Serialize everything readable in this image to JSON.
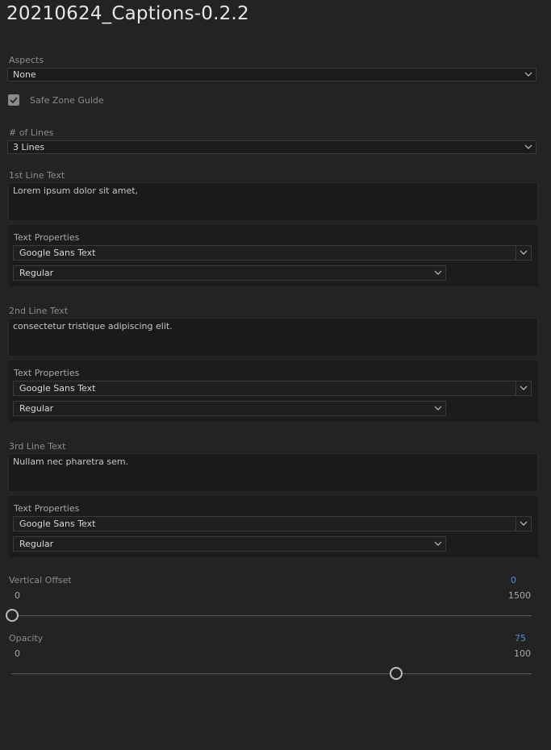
{
  "app": {
    "title": "20210624_Captions-0.2.2"
  },
  "aspects": {
    "label": "Aspects",
    "value": "None"
  },
  "safe_zone": {
    "label": "Safe Zone Guide",
    "checked": true
  },
  "lines": {
    "label": "# of Lines",
    "value": "3 Lines"
  },
  "text_lines": [
    {
      "label": "1st Line Text",
      "value": "Lorem ipsum dolor sit amet,",
      "props_title": "Text Properties",
      "font": "Google Sans Text",
      "style": "Regular"
    },
    {
      "label": "2nd Line Text",
      "value": "consectetur tristique adipiscing elit.",
      "props_title": "Text Properties",
      "font": "Google Sans Text",
      "style": "Regular"
    },
    {
      "label": "3rd Line Text",
      "value": "Nullam nec pharetra sem.",
      "props_title": "Text Properties",
      "font": "Google Sans Text",
      "style": "Regular"
    }
  ],
  "vertical_offset": {
    "label": "Vertical Offset",
    "value": "0",
    "min": "0",
    "max": "1500",
    "fraction": 0
  },
  "opacity": {
    "label": "Opacity",
    "value": "75",
    "min": "0",
    "max": "100",
    "fraction": 0.75
  },
  "colors": {
    "accent": "#4f8fdc",
    "background": "#232323"
  },
  "icons": {
    "dropdown": "chevron-down-icon",
    "check": "checkmark-icon"
  }
}
